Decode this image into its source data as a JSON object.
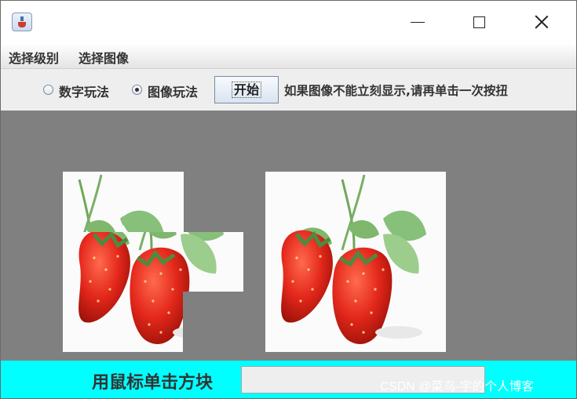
{
  "window": {
    "icon": "java-cup-icon"
  },
  "menu": {
    "items": [
      "选择级别",
      "选择图像"
    ]
  },
  "toolbar": {
    "mode_number_label": "数字玩法",
    "mode_image_label": "图像玩法",
    "selected_mode": "图像玩法",
    "start_label": "开始",
    "note": "如果图像不能立刻显示,请再单击一次按扭"
  },
  "puzzle": {
    "grid": "3x3",
    "tile_sources": [
      [
        1,
        2,
        null
      ],
      [
        3,
        4,
        5
      ],
      [
        6,
        7,
        8
      ]
    ]
  },
  "status": {
    "label": "用鼠标单击方块",
    "field_value": ""
  },
  "watermark": "CSDN @菜鸟-宇的个人博客"
}
